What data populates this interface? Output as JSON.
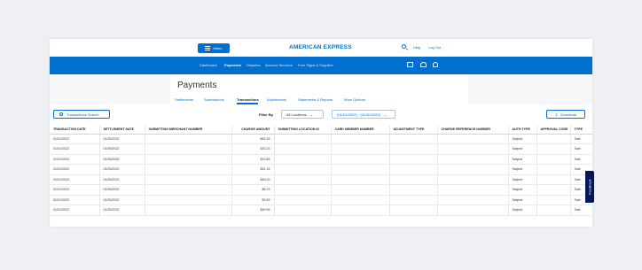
{
  "header": {
    "menu_label": "Menu",
    "brand": "AMERICAN EXPRESS",
    "help": "Help",
    "logout": "Log Out"
  },
  "nav": {
    "items": [
      "Dashboard",
      "Payments",
      "Disputes",
      "Account Services",
      "Free Signs & Supplies"
    ],
    "active": "Payments"
  },
  "payments": {
    "title": "Payments",
    "tabs": [
      "Settlements",
      "Submissions",
      "Transactions",
      "Adjustments",
      "Statements & Reports",
      "More Options"
    ],
    "active_tab": "Transactions"
  },
  "filters": {
    "search_button": "Transactions Search",
    "filter_by": "Filter By",
    "location": "All Locations",
    "date_range": "(01/01/2022) - (01/30/2022)",
    "download": "Download"
  },
  "table": {
    "columns": [
      "Transaction Date",
      "Settlement Date",
      "Submitting Merchant Number",
      "Charge Amount",
      "Submitting Location ID",
      "Card Member Number",
      "Adjustment Type",
      "Charge Reference Number",
      "Auth Type",
      "Approval Code",
      "Type"
    ],
    "rows": [
      [
        "01/01/2022",
        "01/05/2022",
        "",
        "$61.59",
        "",
        "",
        "",
        "",
        "Swiped",
        "",
        "Sale"
      ],
      [
        "01/01/2022",
        "01/05/2022",
        "",
        "$30.23",
        "",
        "",
        "",
        "",
        "Swiped",
        "",
        "Sale"
      ],
      [
        "01/01/2022",
        "01/05/2022",
        "",
        "$19.89",
        "",
        "",
        "",
        "",
        "Swiped",
        "",
        "Sale"
      ],
      [
        "01/01/2022",
        "01/05/2022",
        "",
        "$31.16",
        "",
        "",
        "",
        "",
        "Swiped",
        "",
        "Sale"
      ],
      [
        "01/01/2022",
        "01/05/2022",
        "",
        "$45.00",
        "",
        "",
        "",
        "",
        "Swiped",
        "",
        "Sale"
      ],
      [
        "01/01/2022",
        "01/05/2022",
        "",
        "$8.79",
        "",
        "",
        "",
        "",
        "Swiped",
        "",
        "Sale"
      ],
      [
        "01/01/2022",
        "01/05/2022",
        "",
        "$3.69",
        "",
        "",
        "",
        "",
        "Swiped",
        "",
        "Sale"
      ],
      [
        "01/01/2022",
        "01/05/2022",
        "",
        "$49.59",
        "",
        "",
        "",
        "",
        "Swiped",
        "",
        "Sale"
      ]
    ]
  },
  "feedback": "Feedback",
  "colors": {
    "brand_blue": "#006fcf",
    "navy": "#00175a"
  }
}
